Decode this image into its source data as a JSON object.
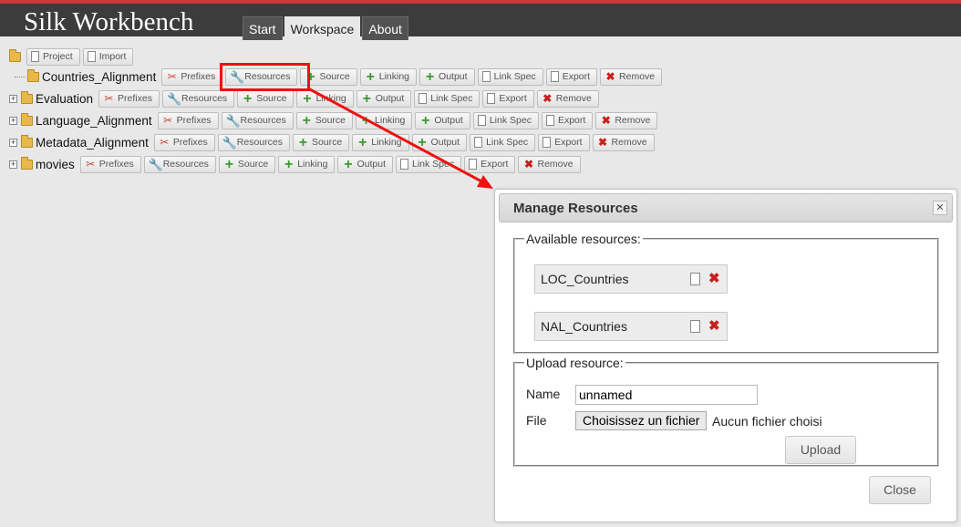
{
  "app": {
    "title": "Silk Workbench"
  },
  "nav": {
    "tabs": [
      "Start",
      "Workspace",
      "About"
    ],
    "active": "Workspace"
  },
  "toolbar": {
    "project_label": "Project",
    "import_label": "Import"
  },
  "actions": {
    "prefixes": "Prefixes",
    "resources": "Resources",
    "source": "Source",
    "linking": "Linking",
    "output": "Output",
    "link_spec": "Link Spec",
    "export": "Export",
    "remove": "Remove"
  },
  "projects": [
    {
      "name": "Countries_Alignment"
    },
    {
      "name": "Evaluation"
    },
    {
      "name": "Language_Alignment"
    },
    {
      "name": "Metadata_Alignment"
    },
    {
      "name": "movies"
    }
  ],
  "dialog": {
    "title": "Manage Resources",
    "available_legend": "Available resources:",
    "resources": [
      "LOC_Countries",
      "NAL_Countries"
    ],
    "upload_legend": "Upload resource:",
    "name_label": "Name",
    "name_value": "unnamed",
    "file_label": "File",
    "file_button": "Choisissez un fichier",
    "file_status": "Aucun fichier choisi",
    "upload_button": "Upload",
    "close_button": "Close"
  },
  "colors": {
    "header_bg": "#3c3c3c",
    "accent": "#c83a3a",
    "highlight": "#ee1111"
  }
}
